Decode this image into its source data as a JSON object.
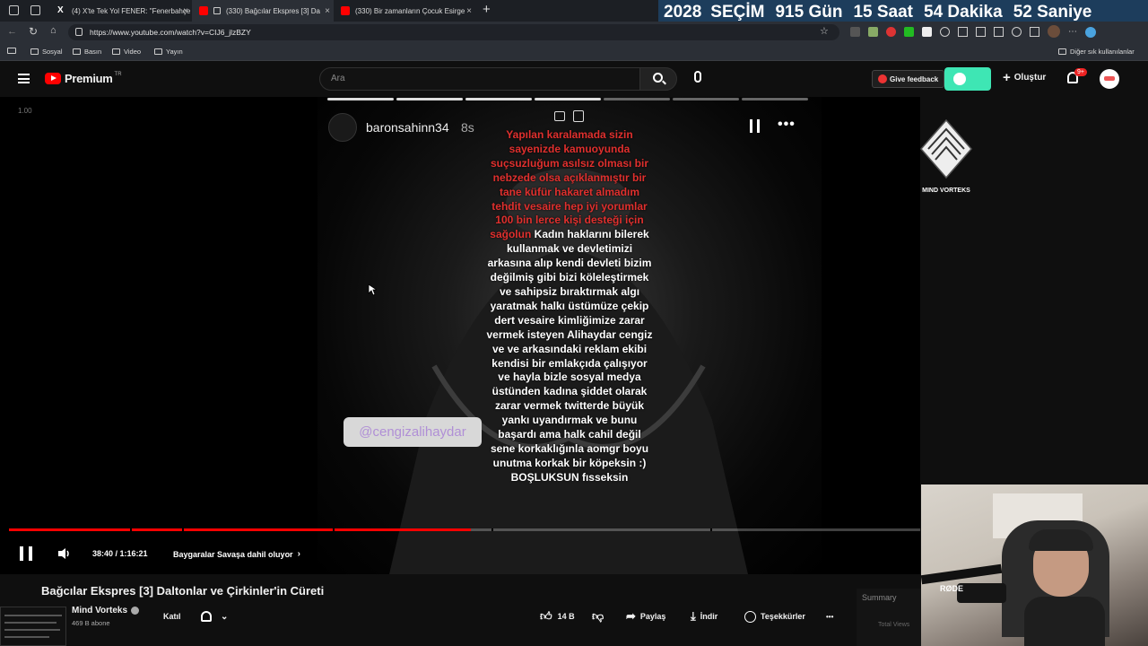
{
  "tabs": [
    {
      "title": "(4) X'te Tek Yol FENER: \"Fenerbahçe",
      "close": "×"
    },
    {
      "title": "(330) Bağcılar Ekspres [3] Da",
      "close": "×"
    },
    {
      "title": "(330) Bir zamanların Çocuk Esirge",
      "close": "×"
    }
  ],
  "new_tab": "+",
  "countdown": {
    "year": "2028",
    "label": "SEÇİM",
    "days": "915 Gün",
    "hours": "15 Saat",
    "minutes": "54 Dakika",
    "seconds": "52 Saniye"
  },
  "address": {
    "url": "https://www.youtube.com/watch?v=CIJ6_jlzBZY"
  },
  "bookmarks": {
    "items": [
      "Sosyal",
      "Basın",
      "Video",
      "Yayın"
    ],
    "other": "Diğer sık kullanılanlar"
  },
  "youtube": {
    "logo_text": "Premium",
    "logo_sup": "TR",
    "search_placeholder": "Ara",
    "give_feedback": "Give feedback",
    "create": "Oluştur",
    "notif_count": "9+"
  },
  "player": {
    "speed": "1.00",
    "time": "38:40 / 1:16:21",
    "chapter": "Baygaralar Savaşa dahil oluyor",
    "progress_fraction": 0.5065
  },
  "story": {
    "username": "baronsahinn34",
    "age": "8s",
    "red_text": "Yapılan karalamada sizin sayenizde kamuoyunda suçsuzluğum asılsız olması bir nebzede olsa açıklanmıştır bir tane küfür hakaret almadım tehdit vesaire hep iyi yorumlar 100 bin lerce kişi desteği için sağolun",
    "white_text": "Kadın haklarını bilerek kullanmak ve devletimizi arkasına alıp kendi devleti bizim değilmiş gibi bizi köleleştirmek ve sahipsiz bıraktırmak algı yaratmak halkı üstümüze çekip dert vesaire kimliğimize zarar vermek isteyen Alihaydar cengiz ve ve arkasındaki reklam ekibi kendisi bir emlakçıda çalışıyor ve hayla bizle sosyal medya üstünden kadına şiddet olarak zarar vermek twitterde büyük yankı uyandırmak ve bunu başardı ama halk cahil değil sene korkaklığınla aomgr boyu unutma korkak bir köpeksin :) BOŞLUKSUN fısseksin",
    "mention": "@cengizalihaydar"
  },
  "channel_logo": {
    "name": "MIND VORTEKS"
  },
  "video": {
    "title": "Bağcılar Ekspres [3] Daltonlar ve Çirkinler'in Cüreti",
    "channel": "Mind Vorteks",
    "subscribers": "469 B abone",
    "join": "Katıl",
    "likes": "14 B",
    "share": "Paylaş",
    "download": "İndir",
    "thanks": "Teşekkürler",
    "more": "•••"
  },
  "side": {
    "summary": "Summary",
    "total_views": "Total Views"
  },
  "webcam": {
    "mic_brand": "RØDE"
  },
  "colors": {
    "accent": "#ff0000",
    "countdown_bg": "#1d3d5c",
    "story_red": "#e0302e"
  }
}
